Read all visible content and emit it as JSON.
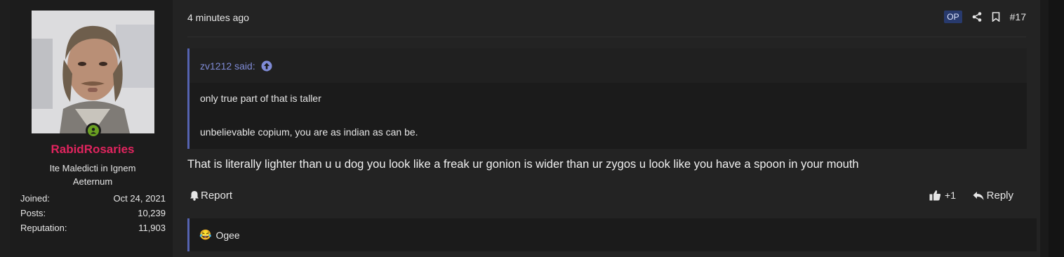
{
  "post": {
    "user": {
      "username": "RabidRosaries",
      "title": "Ite Maledicti in Ignem Aeternum",
      "stats": [
        {
          "label": "Joined:",
          "value": "Oct 24, 2021"
        },
        {
          "label": "Posts:",
          "value": "10,239"
        },
        {
          "label": "Reputation:",
          "value": "11,903"
        }
      ]
    },
    "timestamp": "4 minutes ago",
    "op_badge": "OP",
    "post_number": "#17",
    "quote": {
      "author": "zv1212 said:",
      "lines": [
        "only true part of that is taller",
        "unbelievable copium, you are as indian as can be."
      ]
    },
    "message": "That is literally lighter than u u dog you look like a freak ur gonion is wider than ur zygos u look like you have a spoon in your mouth",
    "actions": {
      "report": "Report",
      "like_count": "+1",
      "reply": "Reply"
    },
    "reaction": {
      "emoji": "😂",
      "names": "Ogee"
    }
  },
  "icons": {
    "share": "share-icon",
    "bookmark": "bookmark-icon",
    "quote_up": "arrow-up-circle-icon",
    "bell": "bell-icon",
    "like": "thumbs-up-icon",
    "reply": "reply-arrow-icon",
    "online": "user-online-icon"
  },
  "colors": {
    "username": "#e0245e",
    "quote_accent": "#5563b0",
    "quote_author": "#7f8bd6",
    "online": "#6aa021",
    "op_badge_bg": "#283a6d"
  }
}
